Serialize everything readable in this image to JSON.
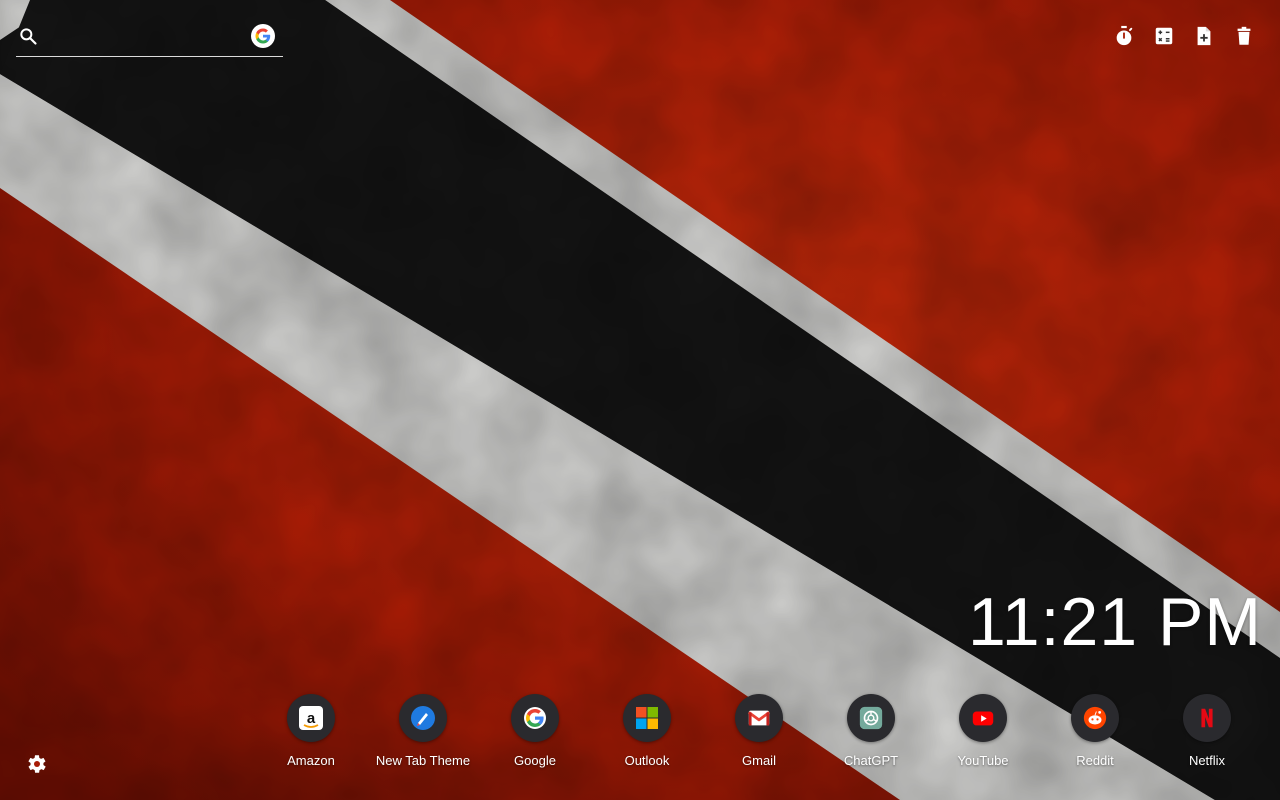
{
  "search": {
    "placeholder": "",
    "value": "",
    "engine_icon": "google-icon"
  },
  "tools": [
    {
      "name": "timer",
      "icon": "stopwatch-icon"
    },
    {
      "name": "calculator",
      "icon": "calculator-icon"
    },
    {
      "name": "notes",
      "icon": "add-note-icon"
    },
    {
      "name": "trash",
      "icon": "trash-icon"
    }
  ],
  "clock": {
    "time": "11:21 PM"
  },
  "shortcuts": [
    {
      "label": "Amazon",
      "icon": "amazon-icon"
    },
    {
      "label": "New Tab Theme",
      "icon": "new-tab-theme-icon"
    },
    {
      "label": "Google",
      "icon": "google-icon"
    },
    {
      "label": "Outlook",
      "icon": "microsoft-icon"
    },
    {
      "label": "Gmail",
      "icon": "gmail-icon"
    },
    {
      "label": "ChatGPT",
      "icon": "chatgpt-icon"
    },
    {
      "label": "YouTube",
      "icon": "youtube-icon"
    },
    {
      "label": "Reddit",
      "icon": "reddit-icon"
    },
    {
      "label": "Netflix",
      "icon": "netflix-icon"
    }
  ],
  "settings": {
    "icon": "gear-icon"
  },
  "colors": {
    "flag_red": "#a81c06",
    "flag_white": "#d9d9d9",
    "flag_black": "#121212",
    "tile_bg": "#2a2a2e"
  }
}
